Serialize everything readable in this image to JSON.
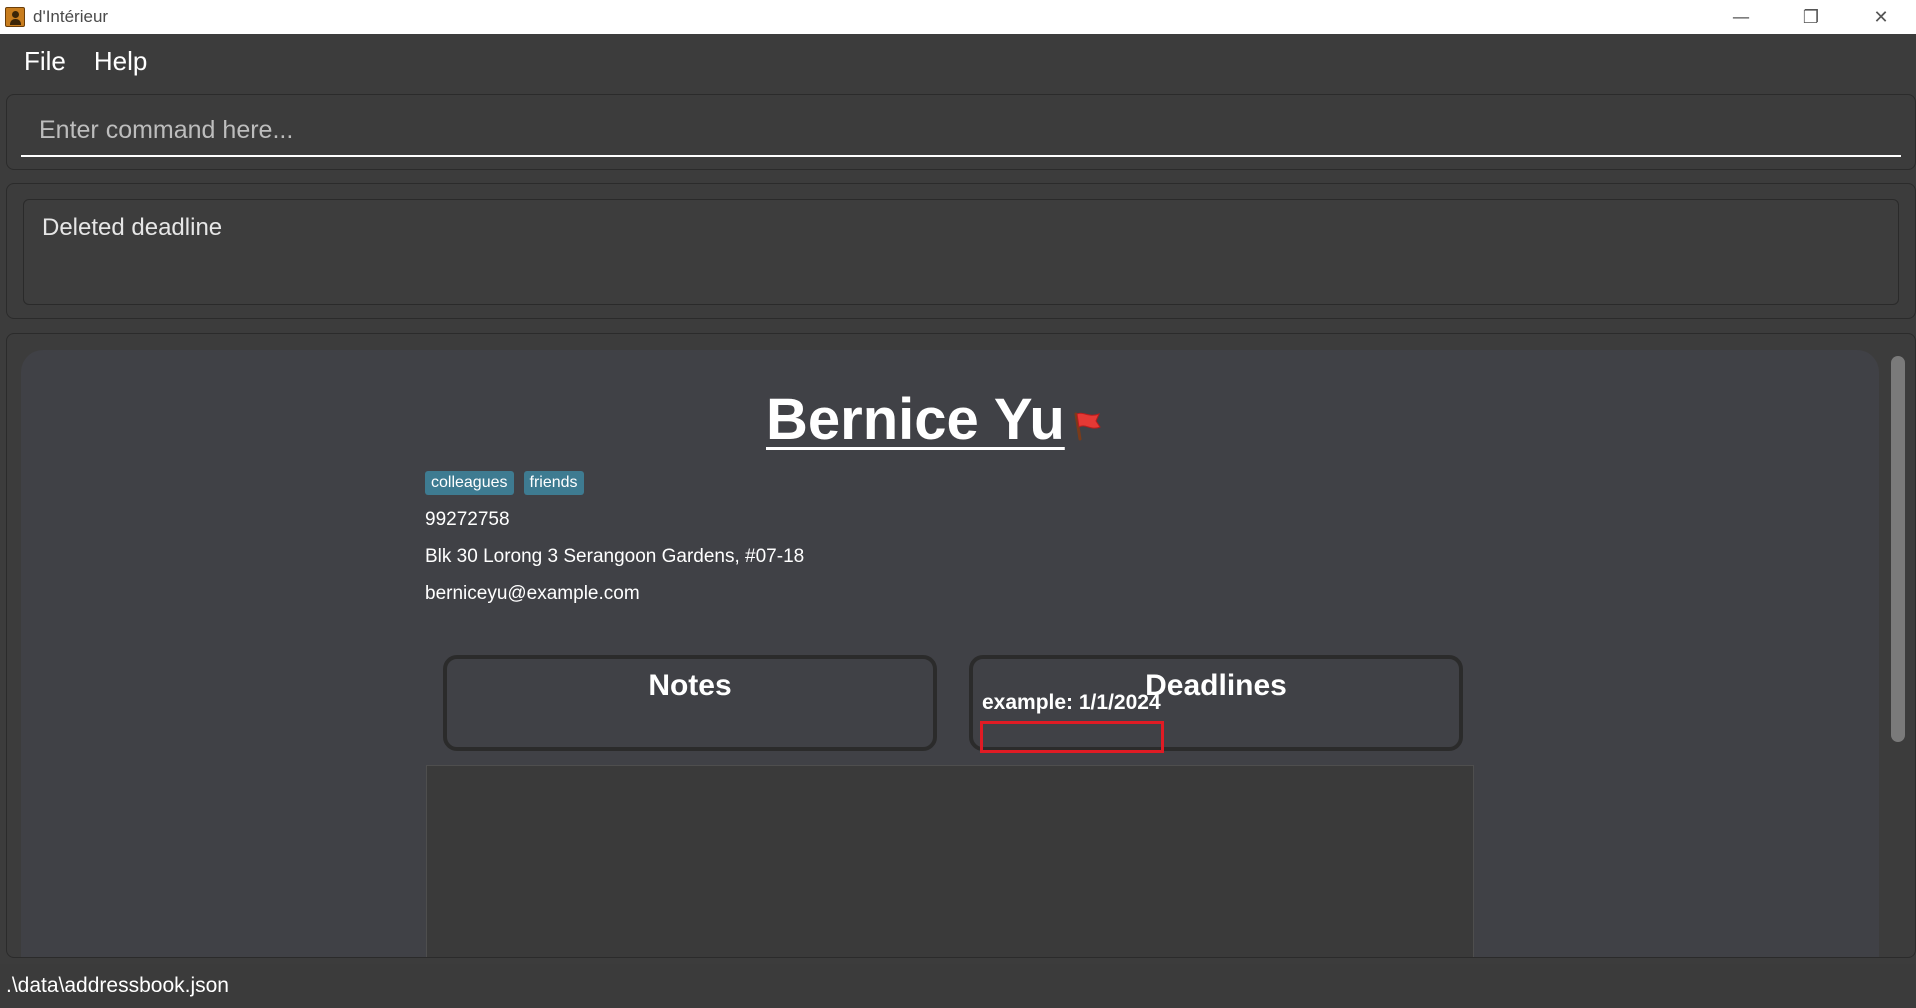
{
  "window": {
    "title": "d'Intérieur",
    "controls": {
      "minimize": "—",
      "restore": "❐",
      "close": "✕"
    }
  },
  "menu": {
    "items": [
      "File",
      "Help"
    ]
  },
  "command": {
    "placeholder": "Enter command here..."
  },
  "result": {
    "message": "Deleted deadline"
  },
  "person": {
    "name": "Bernice Yu",
    "flag_icon": "red-flag-icon",
    "tags": [
      "colleagues",
      "friends"
    ],
    "phone": "99272758",
    "address": "Blk 30 Lorong 3 Serangoon Gardens, #07-18",
    "email": "berniceyu@example.com"
  },
  "sections": {
    "notes_title": "Notes",
    "deadlines_title": "Deadlines",
    "deadlines": [
      "example: 1/1/2024"
    ]
  },
  "status": {
    "path": ".\\data\\addressbook.json"
  },
  "colors": {
    "background": "#3c3c3c",
    "card": "#404146",
    "tag": "#3e7b91",
    "highlight": "#e01b24",
    "flag": "#e53935"
  }
}
